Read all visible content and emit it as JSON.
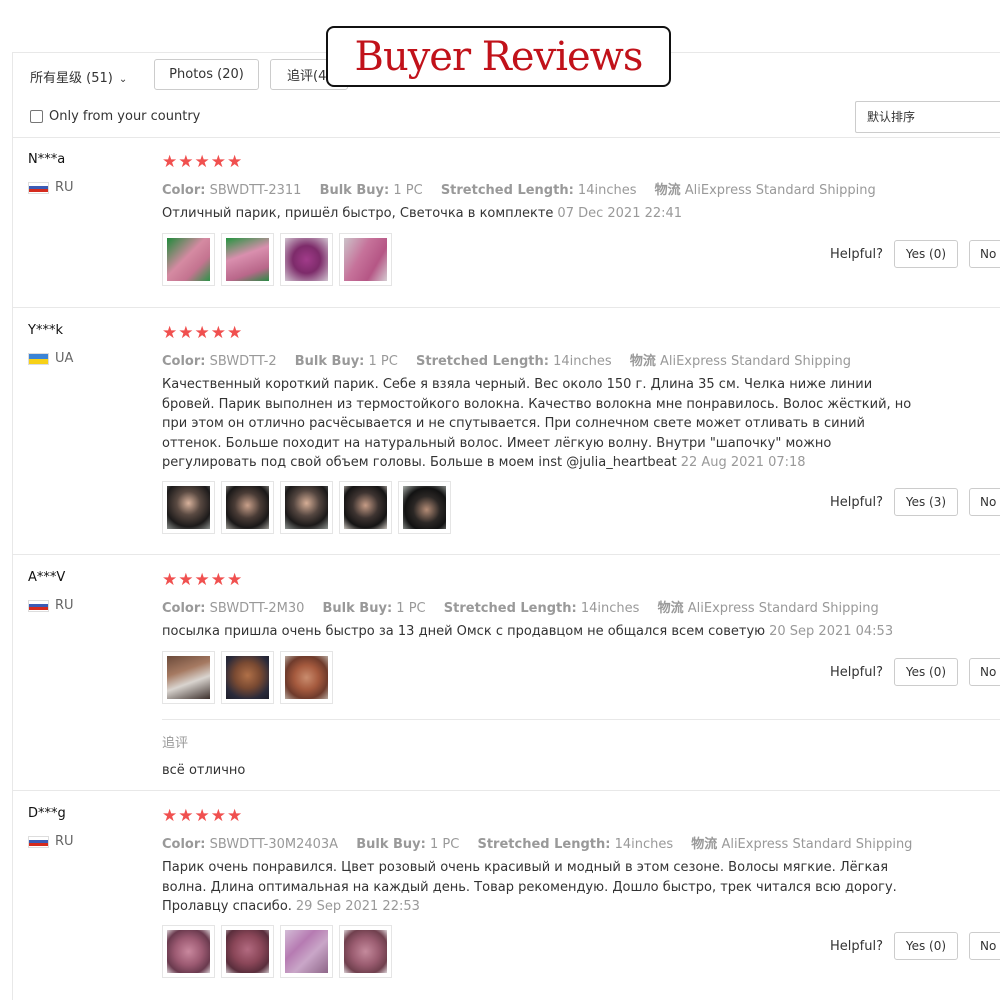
{
  "banner": {
    "title": "Buyer Reviews"
  },
  "filters": {
    "rating_label": "所有星级 (51)",
    "photos_label": "Photos (20)",
    "followup_label": "追评(4)",
    "country_label": "Only from your country",
    "sort_label": "默认排序"
  },
  "helpful_label": "Helpful?",
  "attr_labels": {
    "color": "Color:",
    "bulk": "Bulk Buy:",
    "length": "Stretched Length:",
    "shipping": "物流"
  },
  "reviews": [
    {
      "user": "N***a",
      "country": "RU",
      "flag": "ru",
      "stars": "★★★★★",
      "color": "SBWDTT-2311",
      "bulk": "1 PC",
      "length": "14inches",
      "shipping": "AliExpress Standard Shipping",
      "text": "Отличный парик, пришёл быстро, Светочка в комплекте",
      "date": "07 Dec 2021 22:41",
      "yes": "Yes (0)",
      "no": "No"
    },
    {
      "user": "Y***k",
      "country": "UA",
      "flag": "ua",
      "stars": "★★★★★",
      "color": "SBWDTT-2",
      "bulk": "1 PC",
      "length": "14inches",
      "shipping": "AliExpress Standard Shipping",
      "text": "Качественный короткий парик. Себе я взяла черный. Вес около 150 г. Длина 35 см. Челка ниже линии бровей. Парик выполнен из термостойкого волокна. Качество волокна мне понравилось. Волос жёсткий, но при этом он отлично расчёсывается и не спутывается. При солнечном свете может отливать в синий оттенок. Больше походит на натуральный волос. Имеет лёгкую волну. Внутри \"шапочку\" можно регулировать под свой объем головы. Больше в моем inst @julia_heartbeat",
      "date": "22 Aug 2021 07:18",
      "yes": "Yes (3)",
      "no": "No"
    },
    {
      "user": "A***V",
      "country": "RU",
      "flag": "ru",
      "stars": "★★★★★",
      "color": "SBWDTT-2M30",
      "bulk": "1 PC",
      "length": "14inches",
      "shipping": "AliExpress Standard Shipping",
      "text": "посылка пришла очень быстро за 13 дней Омск с продавцом не общался всем советую",
      "date": "20 Sep 2021 04:53",
      "yes": "Yes (0)",
      "no": "No",
      "followup_label": "追评",
      "followup_text": "всё отлично"
    },
    {
      "user": "D***g",
      "country": "RU",
      "flag": "ru",
      "stars": "★★★★★",
      "color": "SBWDTT-30M2403A",
      "bulk": "1 PC",
      "length": "14inches",
      "shipping": "AliExpress Standard Shipping",
      "text": "Парик очень понравился. Цвет розовый очень красивый и модный в этом сезоне. Волосы мягкие. Лёгкая волна. Длина оптимальная на каждый день. Товар рекомендую. Дошло быстро, трек читался всю дорогу. Пролавцу спасибо.",
      "date": "29 Sep 2021 22:53",
      "yes": "Yes (0)",
      "no": "No"
    }
  ]
}
